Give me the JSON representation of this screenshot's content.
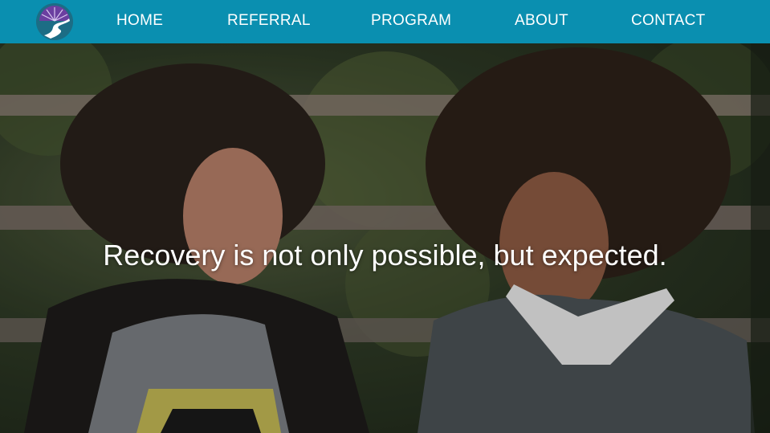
{
  "nav": {
    "logo_icon": "river-sunrise-logo-icon",
    "items": [
      {
        "label": "HOME"
      },
      {
        "label": "REFERRAL"
      },
      {
        "label": "PROGRAM"
      },
      {
        "label": "ABOUT"
      },
      {
        "label": "CONTACT"
      }
    ]
  },
  "hero": {
    "headline": "Recovery is not only possible, but expected.",
    "image": "two-smiling-young-women-photo"
  },
  "colors": {
    "nav_bg": "#0a8fb0",
    "text": "#ffffff"
  }
}
